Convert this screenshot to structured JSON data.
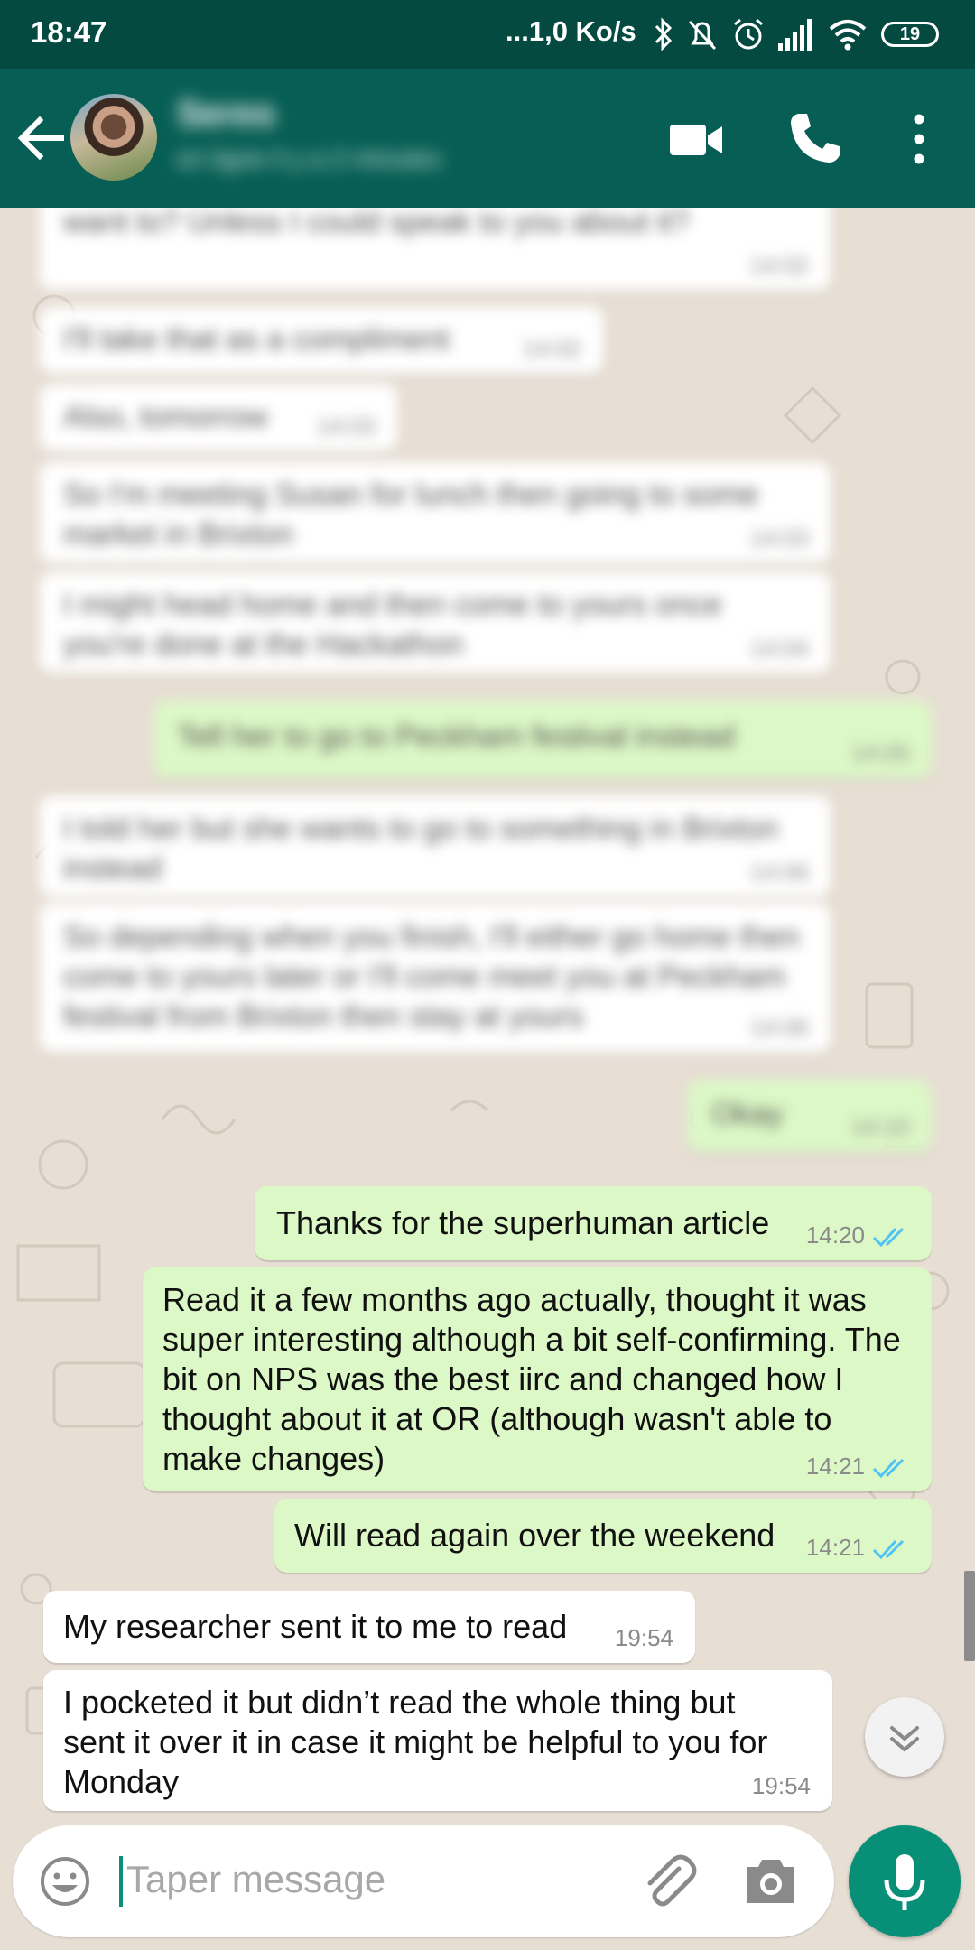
{
  "status_bar": {
    "time": "18:47",
    "net_speed": "...1,0 Ko/s",
    "battery": "19"
  },
  "header": {
    "contact_name": "Seres",
    "contact_status": "en ligne il y a 2 minutes"
  },
  "blurred_messages": [
    {
      "dir": "in",
      "text": "want to? Unless I could speak to you about it?",
      "time": "14:02"
    },
    {
      "dir": "in",
      "text": "I'll take that as a compliment",
      "time": "14:02"
    },
    {
      "dir": "in",
      "text": "Also, tomorrow",
      "time": "14:03"
    },
    {
      "dir": "in",
      "text": "So I'm meeting Susan for lunch then going to some market in Brixton",
      "time": "14:03"
    },
    {
      "dir": "in",
      "text": "I might head home and then come to yours once you're done at the Hackathon",
      "time": "14:04"
    },
    {
      "dir": "out",
      "text": "Tell her to go to Peckham festival instead",
      "time": "14:05"
    },
    {
      "dir": "in",
      "text": "I told her but she wants to go to something in Brixton instead",
      "time": "14:06"
    },
    {
      "dir": "in",
      "text": "So depending when you finish, I'll either go home then come to yours later or I'll come meet you at Peckham festival from Brixton then stay at yours",
      "time": "14:06"
    },
    {
      "dir": "out",
      "text": "Okay",
      "time": "14:10"
    }
  ],
  "messages": [
    {
      "dir": "out",
      "text": "Thanks for the superhuman article",
      "time": "14:20"
    },
    {
      "dir": "out",
      "text": "Read it a few months ago actually, thought it was super interesting although a bit self-confirming. The bit on NPS was the best iirc and changed how I thought about it at OR (although wasn't able to make changes)",
      "time": "14:21"
    },
    {
      "dir": "out",
      "text": "Will read again over the weekend",
      "time": "14:21"
    },
    {
      "dir": "in",
      "text": "My researcher sent it to me to read",
      "time": "19:54"
    },
    {
      "dir": "in",
      "text": "I pocketed it but didn’t read the whole thing but sent it over it in case it might be helpful to you for Monday",
      "time": "19:54"
    }
  ],
  "input": {
    "placeholder": "Taper message"
  },
  "icons": {
    "back": "arrow-left-icon",
    "video": "video-camera-icon",
    "call": "phone-icon",
    "menu": "more-vert-icon",
    "emoji": "emoji-icon",
    "attach": "paperclip-icon",
    "camera": "camera-icon",
    "mic": "microphone-icon",
    "scroll": "double-chevron-down-icon",
    "ticks": "double-check-icon"
  },
  "colors": {
    "header": "#075e54",
    "statusbar": "#054a41",
    "outgoing": "#dcf8c6",
    "incoming": "#ffffff",
    "accent": "#078f78",
    "read_tick": "#4fc3f7"
  }
}
